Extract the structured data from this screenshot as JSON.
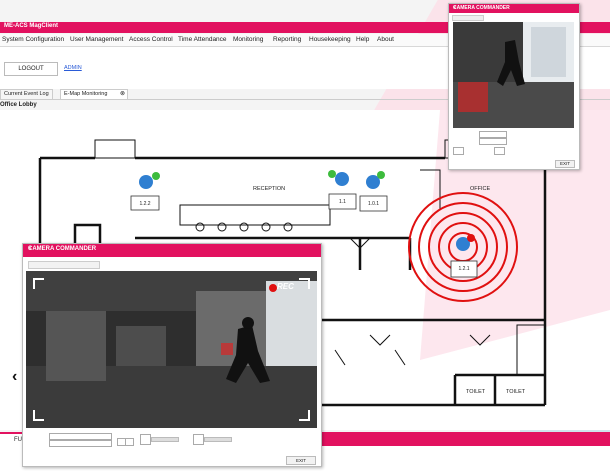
{
  "app": {
    "title": "ME-ACS MagClient"
  },
  "menu": [
    "System Configuration",
    "User Management",
    "Access Control",
    "Time Attendance",
    "Monitoring",
    "Reporting",
    "Housekeeping",
    "Help",
    "About"
  ],
  "toolbar": {
    "logout_label": "LOGOUT",
    "user_link": "ADMIN"
  },
  "tabs": [
    {
      "label": "Current Event Log"
    },
    {
      "label": "E-Map Monitoring"
    }
  ],
  "breadcrumb": "Office Lobby",
  "map": {
    "rooms": {
      "reception": "RECEPTION",
      "office": "OFFICE",
      "toilet1": "TOILET",
      "toilet2": "TOILET"
    },
    "cameras": [
      {
        "id": "1.2.2"
      },
      {
        "id": "1.1"
      },
      {
        "id": "1.0.1"
      },
      {
        "id": "1.2.1",
        "alarm": true
      }
    ]
  },
  "camera_window_main": {
    "title": "CAMERA COMMANDER",
    "rec_label": "REC",
    "exit_label": "EXIT"
  },
  "camera_window_small": {
    "title": "CAMERA COMMANDER",
    "exit_label": "EXIT"
  },
  "bottom": {
    "button_label": "FU"
  },
  "colors": {
    "accent": "#e2115f",
    "alarm_ring": "#e01010"
  }
}
